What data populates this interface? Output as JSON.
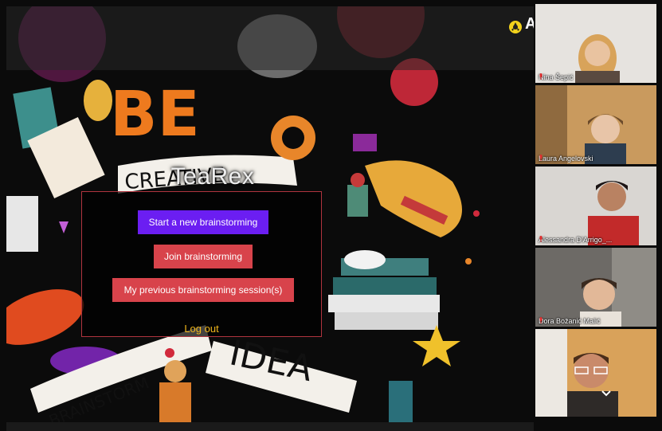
{
  "app": {
    "brand": "TeaRex",
    "top_right_letter": "A",
    "colors": {
      "primary_button": "#6b1ef2",
      "secondary_button": "#d8434b",
      "logout": "#f0b61b",
      "panel_border": "#b0343e"
    }
  },
  "menu": {
    "start_label": "Start a new brainstorming",
    "join_label": "Join brainstorming",
    "previous_label": "My previous brainstorming session(s)",
    "logout_label": "Log out"
  },
  "artwork": {
    "be": "BE",
    "creative": "CREATIVE",
    "idea": "IDEA",
    "brainstorm": "BRAINSTORM"
  },
  "participants": [
    {
      "name": "Nina Šepić",
      "icon": "mic-muted-icon"
    },
    {
      "name": "Laura Angelovski",
      "icon": "mic-muted-icon"
    },
    {
      "name": "Alessandra D'Arrigo_...",
      "icon": "mic-muted-icon"
    },
    {
      "name": "Dora Božanić Malić",
      "icon": "mic-muted-icon"
    },
    {
      "name": "",
      "icon": "mic-muted-icon"
    }
  ],
  "icons": {
    "share": "screen-share-icon",
    "more": "chevron-down-icon"
  }
}
